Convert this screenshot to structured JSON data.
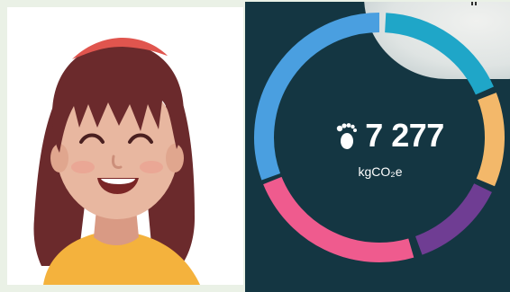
{
  "footprint": {
    "value": "7 277",
    "unit": "kgCO₂e",
    "icon": "footprint-icon",
    "ring_segments": [
      {
        "name": "segment-blue-large",
        "color": "#4a9fe0"
      },
      {
        "name": "segment-teal",
        "color": "#1fa6c8"
      },
      {
        "name": "segment-orange",
        "color": "#f3b86a"
      },
      {
        "name": "segment-purple",
        "color": "#6f3d93"
      },
      {
        "name": "segment-pink",
        "color": "#ef5b8e"
      }
    ]
  },
  "avatar": {
    "icon": "smiling-woman-avatar",
    "colors": {
      "hair": "#6b2a2c",
      "skin": "#e8b7a0",
      "shirt": "#f4b23d",
      "headband": "#e0554e"
    }
  },
  "theme": {
    "panel_bg": "#143642",
    "page_bg": "#eaf1e6"
  }
}
